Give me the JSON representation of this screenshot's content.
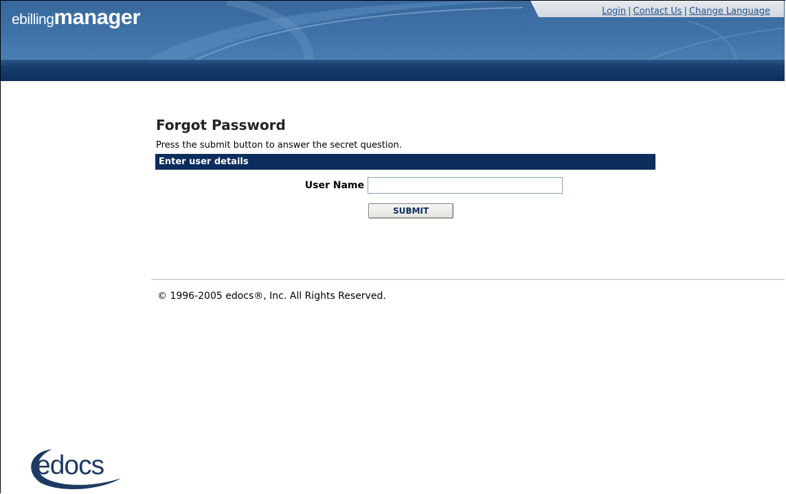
{
  "brand": {
    "prefix": "ebilling",
    "name": "manager"
  },
  "toplinks": {
    "login": "Login",
    "contact": "Contact Us",
    "language": "Change Language",
    "separator": "|"
  },
  "form": {
    "title": "Forgot Password",
    "instruction": "Press the submit button to answer the secret question.",
    "section_header": "Enter user details",
    "username_label": "User Name",
    "username_value": "",
    "submit_label": "SUBMIT"
  },
  "footer": {
    "copyright": "© 1996-2005 edocs®, Inc. All Rights Reserved.",
    "logo": "edocs"
  },
  "colors": {
    "header_blue": "#3f72a8",
    "dark_navy": "#0d2d5d",
    "link_blue": "#26518a"
  }
}
